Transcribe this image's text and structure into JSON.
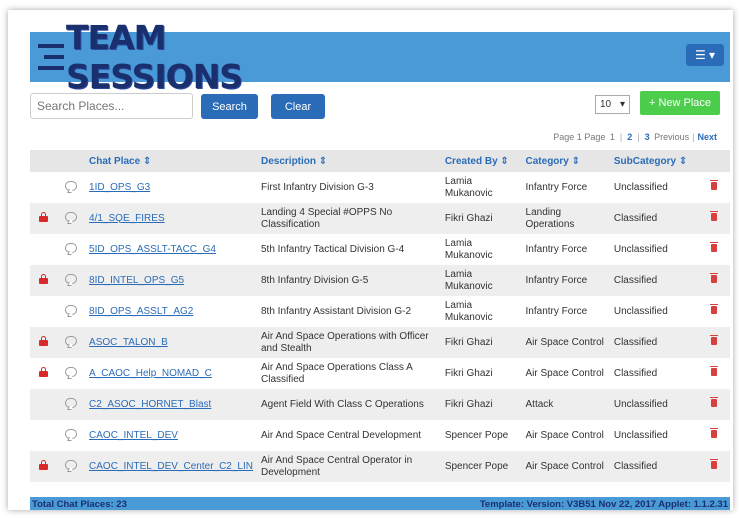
{
  "app": {
    "logo_text": "TEAM SESSIONS"
  },
  "search": {
    "placeholder": "Search Places...",
    "search_label": "Search",
    "clear_label": "Clear"
  },
  "page_size": "10",
  "new_place_label": "+ New Place",
  "pagination": {
    "page_label": "Page",
    "current": "1",
    "page_label2": "Page",
    "pages": [
      "1",
      "2",
      "3"
    ],
    "previous_label": "Previous",
    "next_label": "Next"
  },
  "table": {
    "columns": {
      "chat_place": "Chat Place",
      "description": "Description",
      "created_by": "Created By",
      "category": "Category",
      "subcategory": "SubCategory"
    },
    "sort_icon": "sort-icon",
    "rows": [
      {
        "locked": false,
        "place": "1ID_OPS_G3",
        "description": "First Infantry Division G-3",
        "created_by": "Lamia Mukanovic",
        "category": "Infantry Force",
        "subcategory": "Unclassified"
      },
      {
        "locked": true,
        "place": "4/1_SQE_FIRES",
        "description": "Landing 4 Special #OPPS No Classification",
        "created_by": "Fikri Ghazi",
        "category": "Landing Operations",
        "subcategory": "Classified"
      },
      {
        "locked": false,
        "place": "5ID_OPS_ASSLT-TACC_G4",
        "description": "5th Infantry Tactical Division G-4",
        "created_by": "Lamia Mukanovic",
        "category": "Infantry Force",
        "subcategory": "Unclassified"
      },
      {
        "locked": true,
        "place": "8ID_INTEL_OPS_G5",
        "description": "8th Infantry Division G-5",
        "created_by": "Lamia Mukanovic",
        "category": "Infantry Force",
        "subcategory": "Classified"
      },
      {
        "locked": false,
        "place": "8ID_OPS_ASSLT_AG2",
        "description": "8th Infantry Assistant Division G-2",
        "created_by": "Lamia Mukanovic",
        "category": "Infantry Force",
        "subcategory": "Unclassified"
      },
      {
        "locked": true,
        "place": "ASOC_TALON_B",
        "description": "Air And Space Operations with Officer and Stealth",
        "created_by": "Fikri Ghazi",
        "category": "Air Space Control",
        "subcategory": "Classified"
      },
      {
        "locked": true,
        "place": "A_CAOC_Help_NOMAD_C",
        "description": "Air And Space Operations Class A Classified",
        "created_by": "Fikri Ghazi",
        "category": "Air Space Control",
        "subcategory": "Classified"
      },
      {
        "locked": false,
        "place": "C2_ASOC_HORNET_Blast",
        "description": "Agent Field With Class C Operations",
        "created_by": "Fikri Ghazi",
        "category": "Attack",
        "subcategory": "Unclassified"
      },
      {
        "locked": false,
        "place": "CAOC_INTEL_DEV",
        "description": "Air And Space Central Development",
        "created_by": "Spencer Pope",
        "category": "Air Space Control",
        "subcategory": "Unclassified"
      },
      {
        "locked": true,
        "place": "CAOC_INTEL_DEV_Center_C2_LIN",
        "description": "Air And Space Central Operator in Development",
        "created_by": "Spencer Pope",
        "category": "Air Space Control",
        "subcategory": "Classified"
      }
    ]
  },
  "footer": {
    "total": "Total Chat Places: 23",
    "template_info": "Template: Version: V3B51 Nov 22, 2017  Applet: 1.1.2.31"
  },
  "colors": {
    "header_blue": "#4a9ad8",
    "button_blue": "#2a6cb8",
    "new_green": "#4ccd4c",
    "lock_red": "#d82a2a"
  }
}
